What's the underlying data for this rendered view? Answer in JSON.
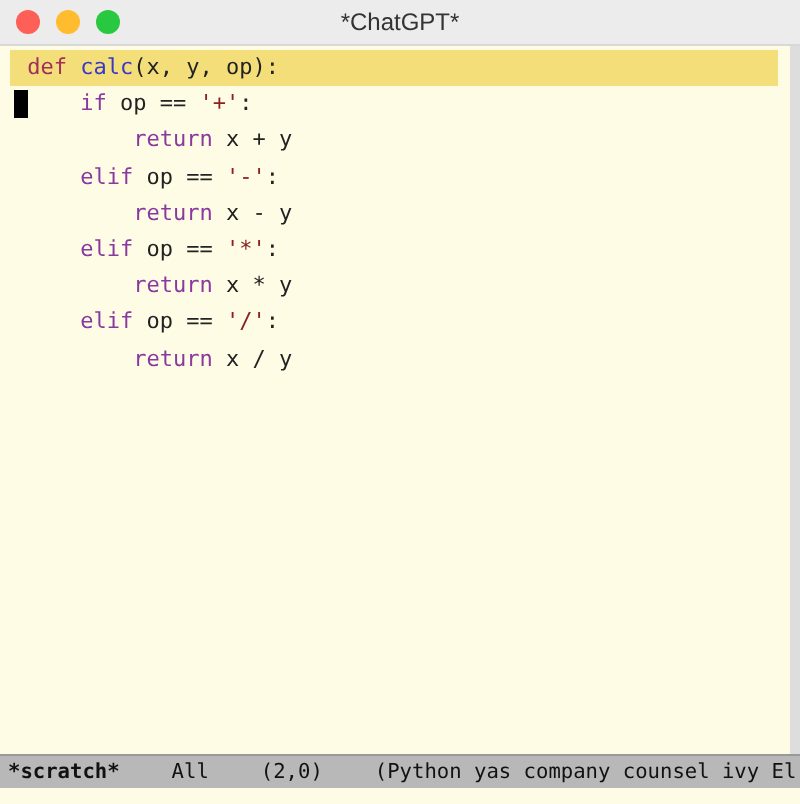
{
  "window": {
    "title": "*ChatGPT*"
  },
  "editor": {
    "lines": [
      {
        "highlighted": true,
        "cursor": false,
        "tokens": [
          {
            "kind": "keyword_def",
            "text": "def"
          },
          {
            "kind": "function",
            "text": " calc"
          },
          {
            "kind": "plain",
            "text": "(x, y, op):"
          }
        ],
        "children": [
          {
            "highlighted": false,
            "cursor": true,
            "tokens": [
              {
                "kind": "keyword",
                "text": "if"
              },
              {
                "kind": "plain",
                "text": " op == "
              },
              {
                "kind": "string",
                "text": "'+'"
              },
              {
                "kind": "plain",
                "text": ":"
              }
            ],
            "children": [
              {
                "highlighted": false,
                "cursor": false,
                "tokens": [
                  {
                    "kind": "keyword",
                    "text": "return"
                  },
                  {
                    "kind": "plain",
                    "text": " x + y"
                  }
                ]
              }
            ]
          },
          {
            "highlighted": false,
            "cursor": false,
            "tokens": [
              {
                "kind": "keyword",
                "text": "elif"
              },
              {
                "kind": "plain",
                "text": " op == "
              },
              {
                "kind": "string",
                "text": "'-'"
              },
              {
                "kind": "plain",
                "text": ":"
              }
            ],
            "children": [
              {
                "highlighted": false,
                "cursor": false,
                "tokens": [
                  {
                    "kind": "keyword",
                    "text": "return"
                  },
                  {
                    "kind": "plain",
                    "text": " x - y"
                  }
                ]
              }
            ]
          },
          {
            "highlighted": false,
            "cursor": false,
            "tokens": [
              {
                "kind": "keyword",
                "text": "elif"
              },
              {
                "kind": "plain",
                "text": " op == "
              },
              {
                "kind": "string",
                "text": "'*'"
              },
              {
                "kind": "plain",
                "text": ":"
              }
            ],
            "children": [
              {
                "highlighted": false,
                "cursor": false,
                "tokens": [
                  {
                    "kind": "keyword",
                    "text": "return"
                  },
                  {
                    "kind": "plain",
                    "text": " x * y"
                  }
                ]
              }
            ]
          },
          {
            "highlighted": false,
            "cursor": false,
            "tokens": [
              {
                "kind": "keyword",
                "text": "elif"
              },
              {
                "kind": "plain",
                "text": " op == "
              },
              {
                "kind": "string",
                "text": "'/'"
              },
              {
                "kind": "plain",
                "text": ":"
              }
            ],
            "children": [
              {
                "highlighted": false,
                "cursor": false,
                "tokens": [
                  {
                    "kind": "keyword",
                    "text": "return"
                  },
                  {
                    "kind": "plain",
                    "text": " x / y"
                  }
                ]
              }
            ]
          }
        ]
      }
    ]
  },
  "mode_line": {
    "buffer": "*scratch*",
    "position": "All",
    "line_col": "(2,0)",
    "modes": "(Python yas company counsel ivy El"
  }
}
